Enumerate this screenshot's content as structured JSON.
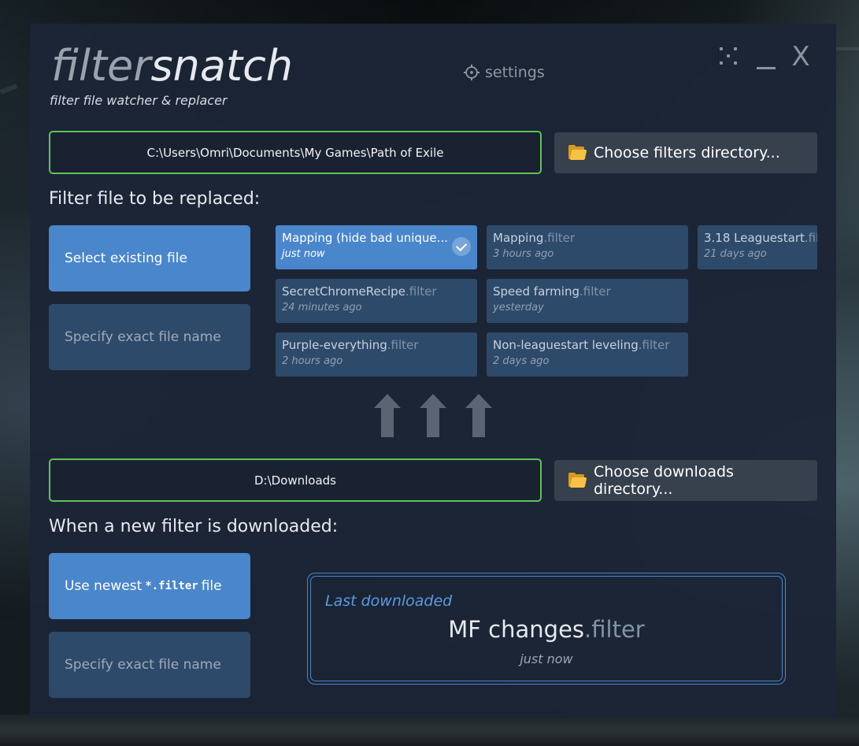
{
  "app": {
    "logo_part1": "filter",
    "logo_part2": "snatch",
    "tagline": "filter file watcher & replacer",
    "settings_label": "settings",
    "close_glyph": "X"
  },
  "filters_dir": {
    "path": "C:\\Users\\Omri\\Documents\\My Games\\Path of Exile",
    "choose_label": "Choose filters directory...",
    "icon": "folder-icon"
  },
  "replace_section": {
    "title": "Filter file to be replaced:",
    "select_existing_label": "Select existing file",
    "specify_exact_label": "Specify exact file name",
    "files": [
      {
        "name": "Mapping (hide bad unique...",
        "ext": "",
        "time": "just now",
        "selected": true
      },
      {
        "name": "Mapping",
        "ext": ".filter",
        "time": "3 hours ago",
        "selected": false
      },
      {
        "name": "3.18 Leaguestart",
        "ext": ".filter",
        "time": "21 days ago",
        "selected": false
      },
      {
        "name": "SecretChromeRecipe",
        "ext": ".filter",
        "time": "24 minutes ago",
        "selected": false
      },
      {
        "name": "Speed farming",
        "ext": ".filter",
        "time": "yesterday",
        "selected": false
      },
      {
        "name": "Purple-everything",
        "ext": ".filter",
        "time": "2 hours ago",
        "selected": false
      },
      {
        "name": "Non-leaguestart leveling",
        "ext": ".filter",
        "time": "2 days ago",
        "selected": false
      }
    ]
  },
  "downloads_dir": {
    "path": "D:\\Downloads",
    "choose_label": "Choose downloads directory...",
    "icon": "folder-icon"
  },
  "download_section": {
    "title": "When a new filter is downloaded:",
    "use_newest_prefix": "Use newest",
    "use_newest_code": "*.filter",
    "use_newest_suffix": "file",
    "specify_exact_label": "Specify exact file name",
    "last_label": "Last downloaded",
    "last_name": "MF changes",
    "last_ext": ".filter",
    "last_time": "just now"
  },
  "colors": {
    "accent": "#4a86cc",
    "valid_border": "#5fc25a",
    "window_bg": "#1c2536"
  }
}
